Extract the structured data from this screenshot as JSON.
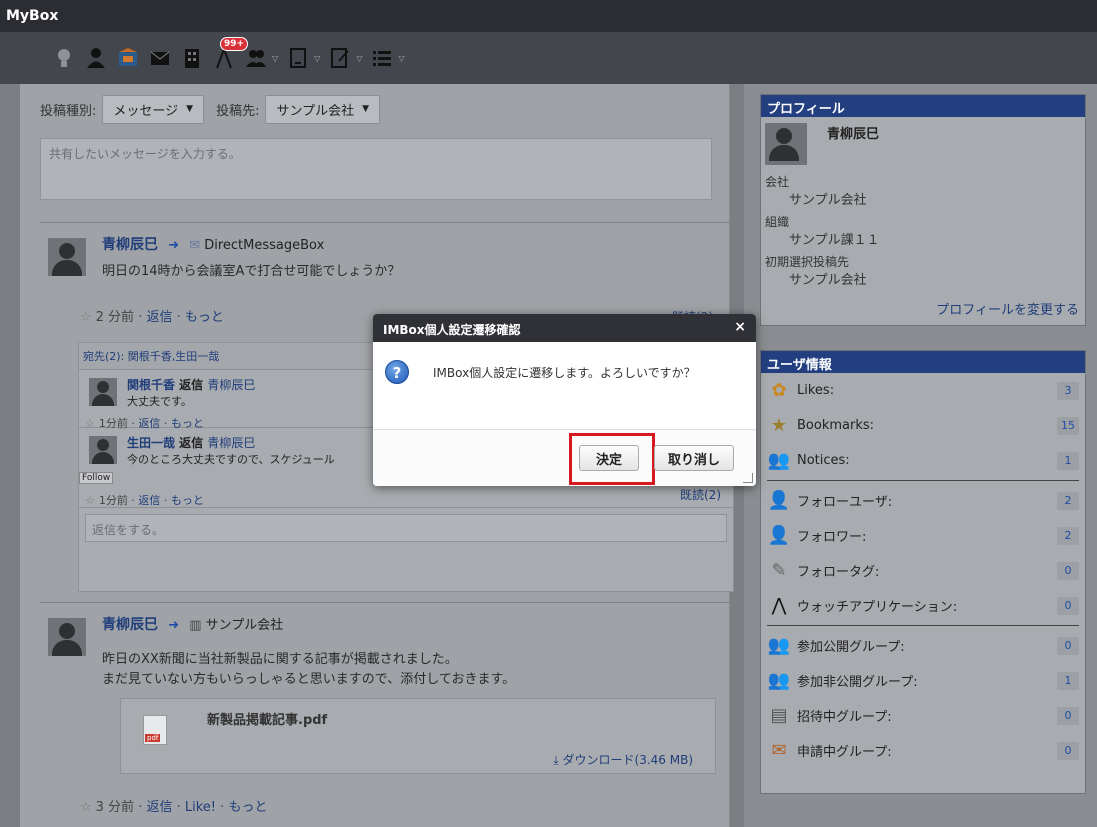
{
  "app": {
    "title": "MyBox"
  },
  "toolbar": {
    "notification_badge": "99+"
  },
  "post_form": {
    "type_label": "投稿種別:",
    "type_value": "メッセージ",
    "target_label": "投稿先:",
    "target_value": "サンプル会社",
    "message_placeholder": "共有したいメッセージを入力する。"
  },
  "posts": [
    {
      "author": "青柳辰巳",
      "target": "DirectMessageBox",
      "text": "明日の14時から会議室Aで打合せ可能でしょうか？",
      "meta": {
        "time": "2 分前",
        "reply": "返信",
        "more": "もっと"
      },
      "read": "既読(2)",
      "recipients": "宛先(2): 関根千香,生田一哉",
      "replies": [
        {
          "author": "関根千香",
          "action": "返信",
          "to": "青柳辰巳",
          "text": "大丈夫です。",
          "time": "1分前",
          "reply": "返信",
          "more": "もっと"
        },
        {
          "author": "生田一哉",
          "action": "返信",
          "to": "青柳辰巳",
          "text": "今のところ大丈夫ですので、スケジュール",
          "follow": "Follow",
          "time": "1分前",
          "reply": "返信",
          "more": "もっと",
          "read": "既読(2)"
        }
      ],
      "reply_placeholder": "返信をする。"
    },
    {
      "author": "青柳辰巳",
      "target": "サンプル会社",
      "text_line1": "昨日のXX新聞に当社新製品に関する記事が掲載されました。",
      "text_line2": "まだ見ていない方もいらっしゃると思いますので、添付しておきます。",
      "attachment": {
        "name": "新製品掲載記事.pdf",
        "download": "ダウンロード(3.46 MB)",
        "pdf_label": "pdf"
      },
      "meta": {
        "time": "3 分前",
        "reply": "返信",
        "like": "Like!",
        "more": "もっと"
      }
    }
  ],
  "profile": {
    "heading": "プロフィール",
    "name": "青柳辰巳",
    "company_label": "会社",
    "company": "サンプル会社",
    "org_label": "組織",
    "org": "サンプル課１１",
    "default_target_label": "初期選択投稿先",
    "default_target": "サンプル会社",
    "edit_link": "プロフィールを変更する"
  },
  "user_info": {
    "heading": "ユーザ情報",
    "items": [
      {
        "label": "Likes:",
        "count": "3"
      },
      {
        "label": "Bookmarks:",
        "count": "15"
      },
      {
        "label": "Notices:",
        "count": "1"
      },
      {
        "label": "フォローユーザ:",
        "count": "2"
      },
      {
        "label": "フォロワー:",
        "count": "2"
      },
      {
        "label": "フォロータグ:",
        "count": "0"
      },
      {
        "label": "ウォッチアプリケーション:",
        "count": "0"
      },
      {
        "label": "参加公開グループ:",
        "count": "0"
      },
      {
        "label": "参加非公開グループ:",
        "count": "1"
      },
      {
        "label": "招待中グループ:",
        "count": "0"
      },
      {
        "label": "申請中グループ:",
        "count": "0"
      }
    ]
  },
  "dialog": {
    "title": "IMBox個人設定遷移確認",
    "close": "×",
    "message": "IMBox個人設定に遷移します。よろしいですか？",
    "ok": "決定",
    "cancel": "取り消し"
  },
  "colors": {
    "header_bg": "#2b2d33",
    "panel_head": "#233f80",
    "highlight": "#d7181f",
    "link": "#1f3d7a"
  }
}
